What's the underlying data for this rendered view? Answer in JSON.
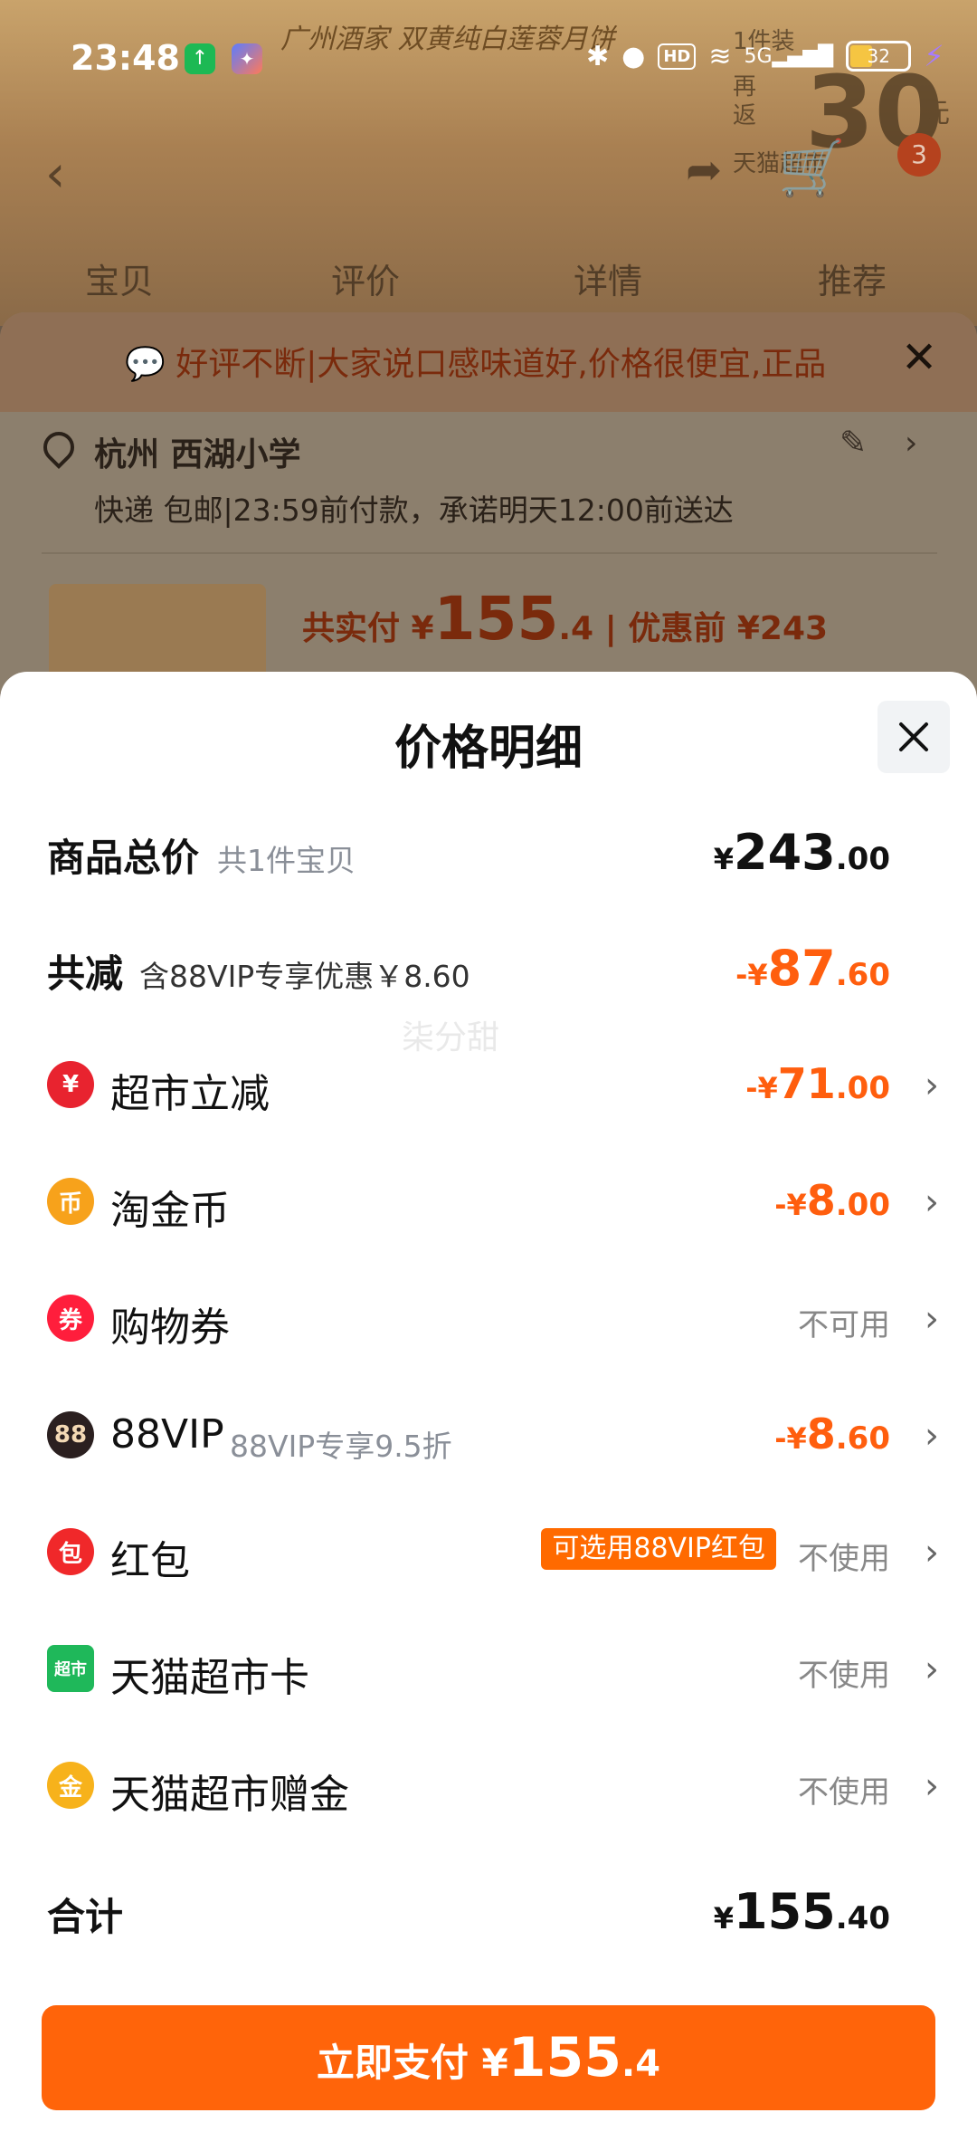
{
  "status_bar": {
    "time": "23:48",
    "battery": "32",
    "hd": "HD",
    "network": "5G"
  },
  "background": {
    "banner_text": "广州酒家 双黄纯白莲蓉月饼",
    "promo_1": "1件装",
    "promo_2": "再返",
    "promo_3": "30",
    "promo_4": "元",
    "promo_5": "天猫超市",
    "cart_badge": "3",
    "tabs": [
      "宝贝",
      "评价",
      "详情",
      "推荐"
    ],
    "tip": "好评不断|大家说口感味道好,价格很便宜,正品",
    "address_city": "杭州 西湖小学",
    "shipping": "快递 包邮|23:59前付款，承诺明天12:00前送达",
    "pay_label": "共实付 ¥",
    "pay_int": "155",
    "pay_dec": ".4",
    "pay_before": "| 优惠前 ¥243"
  },
  "modal": {
    "title": "价格明细",
    "watermark": "柒分甜",
    "total_goods": {
      "label": "商品总价",
      "sub": "共1件宝贝",
      "cur": "¥",
      "int": "243",
      "dec": ".00"
    },
    "total_discount": {
      "label": "共减",
      "sub": "含88VIP专享优惠￥8.60",
      "cur": "-¥",
      "int": "87",
      "dec": ".60"
    },
    "items": [
      {
        "label": "超市立减",
        "icon": "¥",
        "cur": "-¥",
        "int": "71",
        "dec": ".00"
      },
      {
        "label": "淘金币",
        "icon": "币",
        "cur": "-¥",
        "int": "8",
        "dec": ".00"
      },
      {
        "label": "购物券",
        "icon": "券",
        "status": "不可用"
      },
      {
        "label": "88VIP",
        "icon": "88",
        "sub": "88VIP专享9.5折",
        "cur": "-¥",
        "int": "8",
        "dec": ".60"
      },
      {
        "label": "红包",
        "icon": "包",
        "tag": "可选用88VIP红包",
        "status": "不使用"
      },
      {
        "label": "天猫超市卡",
        "icon": "超市",
        "status": "不使用"
      },
      {
        "label": "天猫超市赠金",
        "icon": "金",
        "status": "不使用"
      }
    ],
    "sum": {
      "label": "合计",
      "cur": "¥",
      "int": "155",
      "dec": ".40"
    },
    "pay_button": {
      "text": "立即支付 ¥",
      "int": "155",
      "dec": ".4"
    }
  },
  "colors": {
    "accent": "#ff640a",
    "discount": "#ff5e0e"
  }
}
